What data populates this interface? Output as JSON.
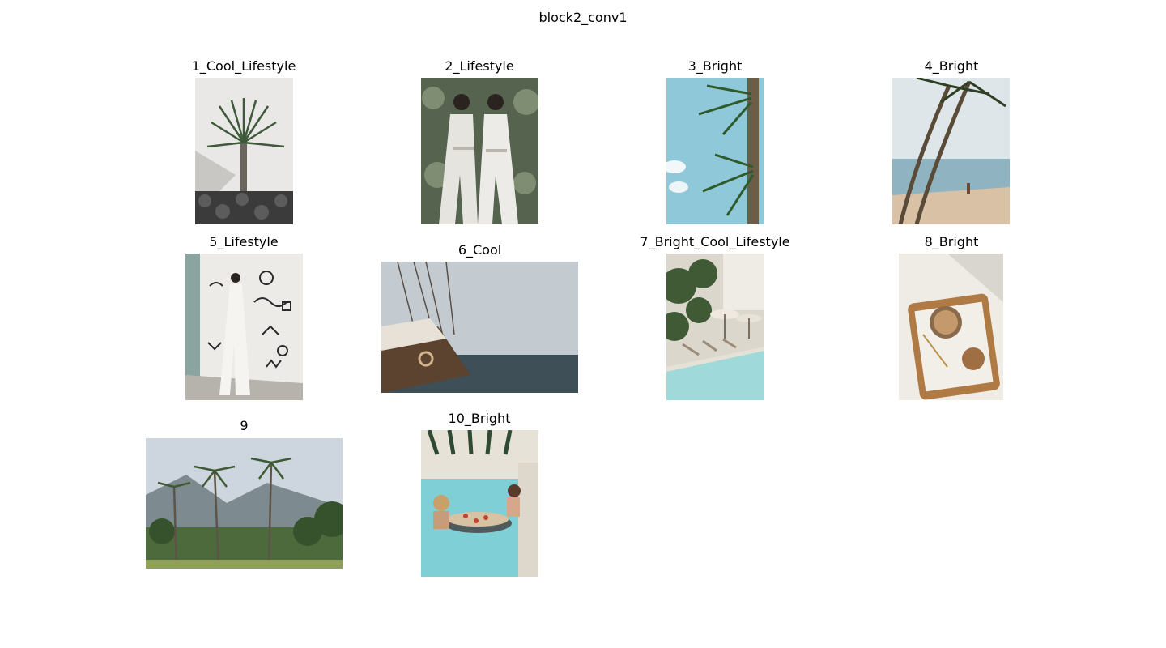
{
  "figure": {
    "title": "block2_conv1",
    "panels": [
      {
        "label": "1_Cool_Lifestyle",
        "image": "palm-on-lava-wall-photo"
      },
      {
        "label": "2_Lifestyle",
        "image": "two-women-white-jumpsuits-photo"
      },
      {
        "label": "3_Bright",
        "image": "palm-fronds-blue-sky-photo"
      },
      {
        "label": "4_Bright",
        "image": "beach-palms-walker-photo"
      },
      {
        "label": "5_Lifestyle",
        "image": "woman-doodle-wall-photo"
      },
      {
        "label": "6_Cool",
        "image": "sailboat-grey-sea-photo"
      },
      {
        "label": "7_Bright_Cool_Lifestyle",
        "image": "pool-umbrellas-loungers-photo"
      },
      {
        "label": "8_Bright",
        "image": "coffee-tray-flatlay-photo"
      },
      {
        "label": "9",
        "image": "tropical-palms-mountains-photo"
      },
      {
        "label": "10_Bright",
        "image": "pool-floating-breakfast-photo"
      }
    ]
  }
}
